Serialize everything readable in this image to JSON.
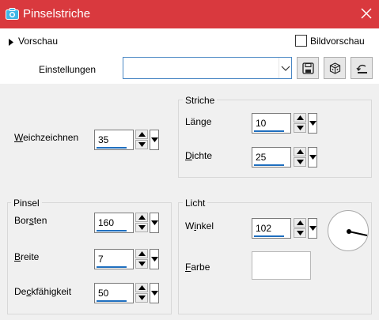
{
  "window": {
    "title": "Pinselstriche",
    "icon": "camera-icon",
    "accent": "#d9393e"
  },
  "preview": {
    "label": "Vorschau",
    "checkbox_label": "Bildvorschau",
    "checked": false
  },
  "settings": {
    "label": "Einstellungen",
    "value": ""
  },
  "toolbar": {
    "icons": [
      "save-icon",
      "randomize-dice-icon",
      "reset-icon"
    ]
  },
  "weich": {
    "label": "Weichzeichnen",
    "accesskey": "W",
    "rest": "eichzeichnen",
    "value": "35"
  },
  "striche": {
    "title": "Striche",
    "laenge": {
      "label": "Länge",
      "before": "Län",
      "accesskey": "g",
      "after": "e",
      "value": "10"
    },
    "dichte": {
      "label": "Dichte",
      "accesskey": "D",
      "rest": "ichte",
      "value": "25"
    }
  },
  "pinsel": {
    "title": "Pinsel",
    "borsten": {
      "label": "Borsten",
      "before": "Bor",
      "accesskey": "s",
      "after": "ten",
      "value": "160"
    },
    "breite": {
      "label": "Breite",
      "accesskey": "B",
      "rest": "reite",
      "value": "7"
    },
    "deck": {
      "label": "Deckfähigkeit",
      "before": "De",
      "accesskey": "c",
      "after": "kfähigkeit",
      "value": "50"
    }
  },
  "licht": {
    "title": "Licht",
    "winkel": {
      "label": "Winkel",
      "before": "W",
      "accesskey": "i",
      "after": "nkel",
      "value": "102"
    },
    "farbe": {
      "label": "Farbe",
      "accesskey": "F",
      "rest": "arbe",
      "color": "#ffffff"
    }
  }
}
